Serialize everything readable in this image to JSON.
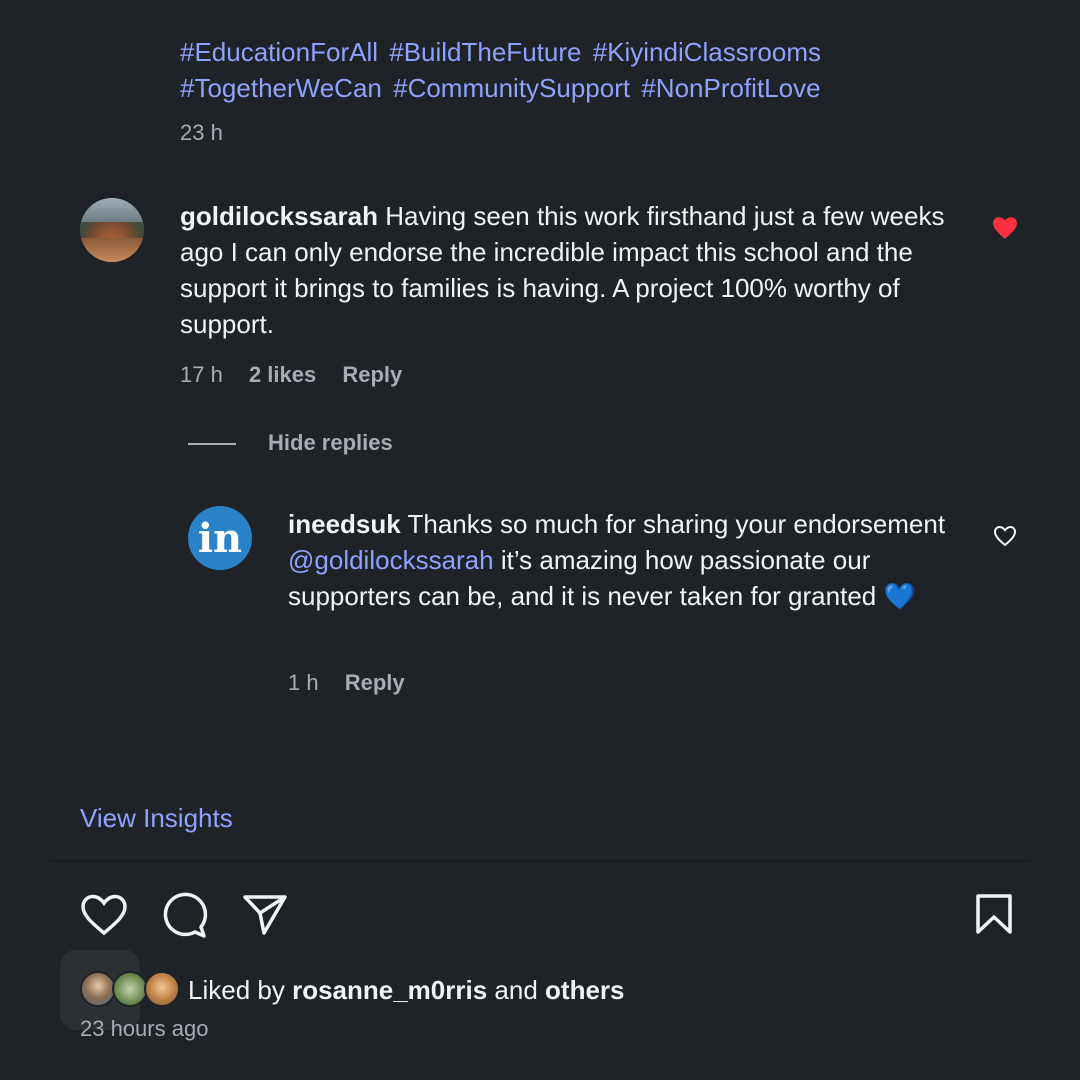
{
  "post": {
    "hashtags": [
      "#EducationForAll",
      "#BuildTheFuture",
      "#KiyindiClassrooms",
      "#TogetherWeCan",
      "#CommunitySupport",
      "#NonProfitLove"
    ],
    "time": "23 h"
  },
  "comment": {
    "user": "goldilockssarah",
    "text": "Having seen this work firsthand just a few weeks ago I can only endorse the incredible impact this school and the support it brings to families is having. A project 100% worthy of support.",
    "time": "17 h",
    "likes": "2 likes",
    "reply_label": "Reply",
    "liked_color": "#ff3040"
  },
  "replies_toggle": "Hide replies",
  "reply": {
    "avatar_letter": "in",
    "user": "ineedsuk",
    "text_before": "Thanks so much for sharing your endorsement",
    "mention": "@goldilockssarah",
    "text_after": "it’s amazing how passionate our supporters can be, and it is never taken for granted",
    "emoji": "💙",
    "time": "1 h",
    "reply_label": "Reply"
  },
  "view_insights": "View Insights",
  "likes_summary": {
    "prefix": "Liked by",
    "user": "rosanne_m0rris",
    "middle": "and",
    "suffix": "others"
  },
  "timestamp": "23 hours ago",
  "icons": [
    "heart-icon",
    "comment-icon",
    "share-icon",
    "bookmark-icon"
  ],
  "colors": {
    "accent": "#8ea2ff",
    "background": "#1f2227",
    "muted": "#a8acb3"
  }
}
